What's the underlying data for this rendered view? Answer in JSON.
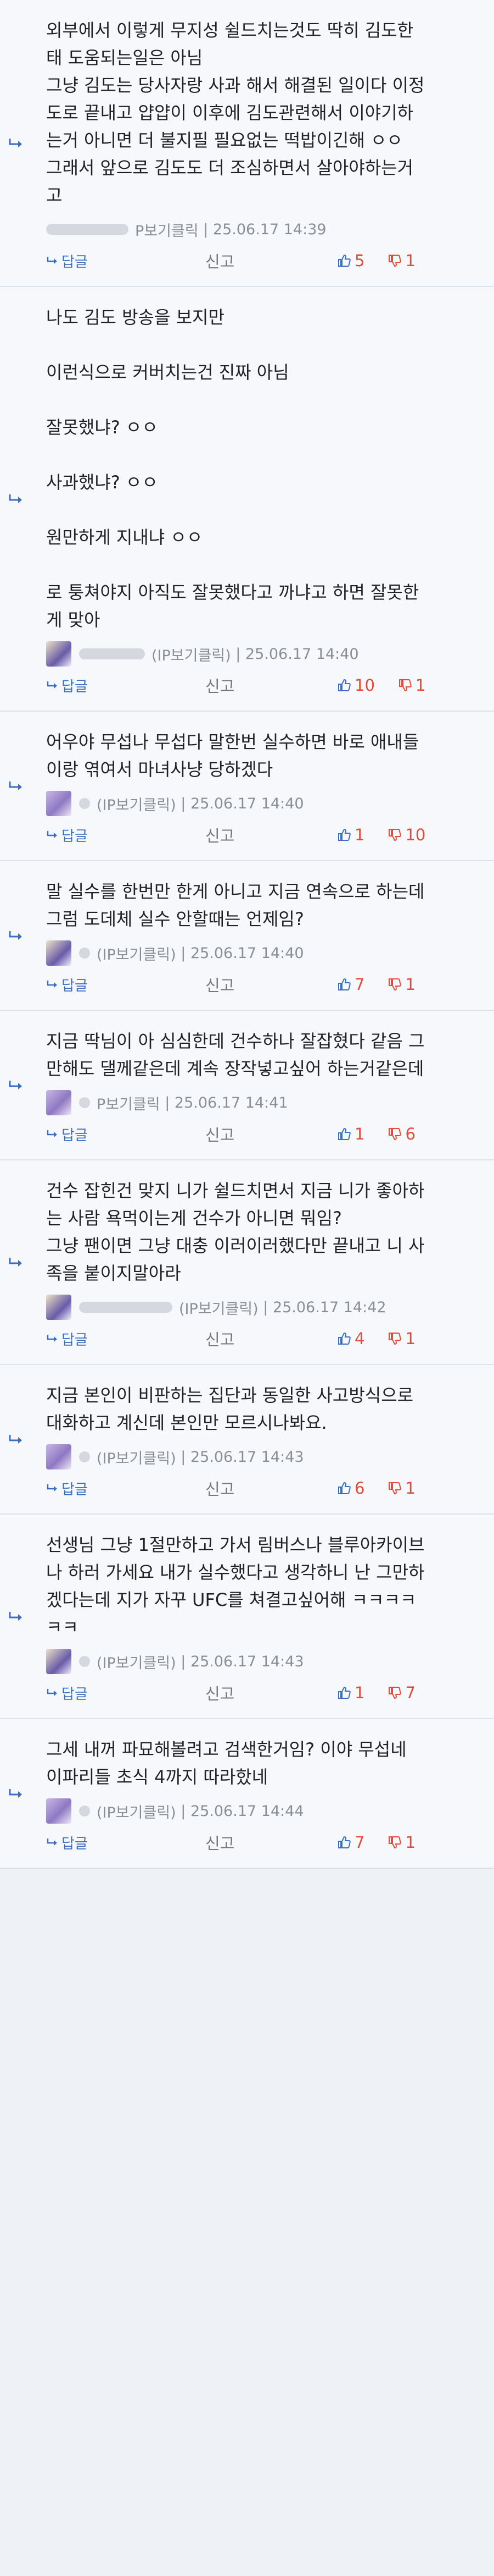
{
  "labels": {
    "reply": "답글",
    "report": "신고"
  },
  "colors": {
    "accent": "#3a6fc4",
    "count": "#e44a3a"
  },
  "comments": [
    {
      "lines": [
        "외부에서 이렇게 무지성 쉴드치는것도 딱히 김도한",
        "태 도움되는일은 아님",
        "그냥 김도는 당사자랑 사과 해서 해결된 일이다 이정",
        "도로 끝내고 얍얍이 이후에 김도관련해서 이야기하",
        "는거 아니면 더 불지필 필요없는 떡밥이긴해 ㅇㅇ",
        "그래서 앞으로 김도도 더 조심하면서 살아야하는거",
        "고"
      ],
      "author": "P보기클릭",
      "date": "25.06.17 14:39",
      "up": "5",
      "down": "1"
    },
    {
      "lines": [
        "나도 김도 방송을 보지만",
        "",
        "이런식으로 커버치는건 진짜 아님",
        "",
        "잘못했냐? ㅇㅇ",
        "",
        "사과했냐? ㅇㅇ",
        "",
        "원만하게 지내냐 ㅇㅇ",
        "",
        "로 퉁쳐야지 아직도 잘못했다고 까냐고 하면 잘못한",
        "게 맞아"
      ],
      "author": "(IP보기클릭)",
      "date": "25.06.17 14:40",
      "up": "10",
      "down": "1"
    },
    {
      "lines": [
        "어우야 무섭나 무섭다 말한번 실수하면 바로 애내들",
        "이랑 엮여서 마녀사냥 당하겠다"
      ],
      "author": "(IP보기클릭)",
      "date": "25.06.17 14:40",
      "up": "1",
      "down": "10"
    },
    {
      "lines": [
        "말 실수를 한번만 한게 아니고 지금 연속으로 하는데",
        "그럼 도데체 실수 안할때는 언제임?"
      ],
      "author": "(IP보기클릭)",
      "date": "25.06.17 14:40",
      "up": "7",
      "down": "1"
    },
    {
      "lines": [
        "지금 딱님이 아 심심한데 건수하나 잘잡혔다 같음 그",
        "만해도 댈께같은데 계속 장작넣고싶어 하는거같은데"
      ],
      "author": "P보기클릭",
      "date": "25.06.17 14:41",
      "up": "1",
      "down": "6"
    },
    {
      "lines": [
        "건수 잡힌건 맞지 니가 쉴드치면서 지금 니가 좋아하",
        "는 사람 욕먹이는게 건수가 아니면 뭐임?",
        "그냥 팬이면 그냥 대충 이러이러했다만 끝내고 니 사",
        "족을 붙이지말아라"
      ],
      "author": "(IP보기클릭)",
      "date": "25.06.17 14:42",
      "up": "4",
      "down": "1"
    },
    {
      "lines": [
        "지금 본인이 비판하는 집단과 동일한 사고방식으로",
        "대화하고 계신데 본인만 모르시나봐요."
      ],
      "author": "(IP보기클릭)",
      "date": "25.06.17 14:43",
      "up": "6",
      "down": "1"
    },
    {
      "lines": [
        "선생님 그냥 1절만하고 가서 림버스나 블루아카이브",
        "나 하러 가세요 내가 실수했다고 생각하니 난 그만하",
        "겠다는데 지가 자꾸 UFC를 쳐결고싶어해 ㅋㅋㅋㅋ",
        "ㅋㅋ"
      ],
      "author": "(IP보기클릭)",
      "date": "25.06.17 14:43",
      "up": "1",
      "down": "7"
    },
    {
      "lines": [
        "그세 내꺼 파묘해볼려고 검색한거임? 이야 무섭네",
        "이파리들 초식 4까지 따라핬네"
      ],
      "author": "(IP보기클릭)",
      "date": "25.06.17 14:44",
      "up": "7",
      "down": "1"
    }
  ]
}
